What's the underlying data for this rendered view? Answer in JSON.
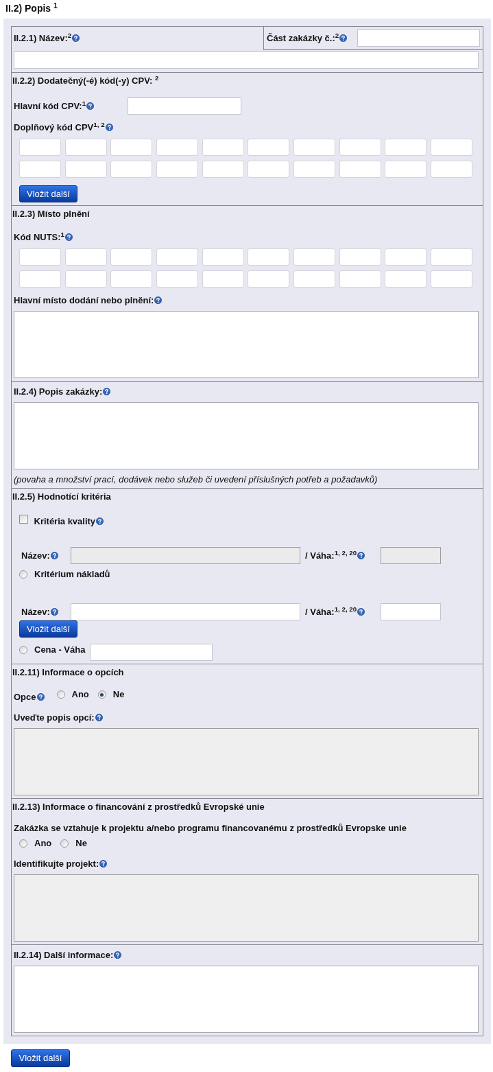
{
  "title": "II.2) Popis $^{1}$",
  "sections": [
    {
      "kind": "name_part",
      "name_label": {
        "text": "II.2.1) Název:$^{2}$",
        "help": true
      },
      "part_label": {
        "text": "Část zakázky č.:$^{2}$",
        "help": true
      }
    },
    {
      "kind": "group",
      "heading": {
        "text": "II.2.2) Dodatečný(-é) kód(-y) CPV: $^{2}$",
        "help": false
      },
      "items": [
        {
          "kind": "inline_field",
          "label": {
            "text": "Hlavní kód CPV:$^{1}$",
            "help": true
          }
        },
        {
          "kind": "label",
          "label": {
            "text": "Doplňový kód CPV$^{1, 2}$",
            "help": true
          }
        },
        {
          "kind": "field_grid"
        },
        {
          "kind": "button",
          "text": "Vložit další"
        }
      ]
    },
    {
      "kind": "group",
      "heading": {
        "text": "II.2.3) Místo plnění",
        "help": false
      },
      "items": [
        {
          "kind": "label",
          "label": {
            "text": "Kód NUTS:$^{1}$",
            "help": true
          }
        },
        {
          "kind": "field_grid"
        },
        {
          "kind": "label",
          "label": {
            "text": "Hlavní místo dodání nebo plnění:",
            "help": true
          }
        },
        {
          "kind": "textarea",
          "disabled": false
        }
      ]
    },
    {
      "kind": "group",
      "heading": {
        "text": "II.2.4) Popis zakázky:",
        "help": true
      },
      "items": [
        {
          "kind": "textarea",
          "disabled": false
        },
        {
          "kind": "note",
          "text": "(povaha a množství prací, dodávek nebo služeb či uvedení příslušných potřeb a požadavků)"
        }
      ]
    },
    {
      "kind": "group",
      "heading": {
        "text": "II.2.5) Hodnotící kritéria",
        "help": false
      },
      "items": [
        {
          "kind": "checkbox",
          "label": {
            "text": "Kritéria kvality",
            "help": true
          },
          "checked": false
        },
        {
          "kind": "criterion",
          "disabled": true,
          "name_label": {
            "text": "Název:",
            "help": true
          },
          "weight_label": {
            "text": "/ Váha:$^{1, 2, 20}$",
            "help": true
          }
        },
        {
          "kind": "radio",
          "label": {
            "text": "Kritérium nákladů",
            "help": false
          },
          "selected": false
        },
        {
          "kind": "criterion",
          "disabled": false,
          "name_label": {
            "text": "Název:",
            "help": true
          },
          "weight_label": {
            "text": "/ Váha:$^{1, 2, 20}$",
            "help": true
          }
        },
        {
          "kind": "button",
          "text": "Vložit další"
        },
        {
          "kind": "radio_field",
          "label": {
            "text": "Cena - Váha",
            "help": false
          },
          "selected": false
        }
      ]
    },
    {
      "kind": "group",
      "heading": {
        "text": "II.2.11) Informace o opcích",
        "help": false
      },
      "items": [
        {
          "kind": "radio_group",
          "label": {
            "text": "Opce",
            "help": true
          },
          "options": [
            {
              "text": "Ano",
              "selected": false
            },
            {
              "text": "Ne",
              "selected": true
            }
          ]
        },
        {
          "kind": "label",
          "label": {
            "text": "Uveďte popis opcí:",
            "help": true
          }
        },
        {
          "kind": "textarea",
          "disabled": true
        }
      ]
    },
    {
      "kind": "group",
      "heading": {
        "text": "II.2.13) Informace o financování z prostředků Evropské unie",
        "help": false
      },
      "items": [
        {
          "kind": "question",
          "label": {
            "text": "Zakázka se vztahuje k projektu a/nebo programu financovanému z prostředků Evropske unie",
            "help": false
          }
        },
        {
          "kind": "radio_group",
          "options": [
            {
              "text": "Ano",
              "selected": false
            },
            {
              "text": "Ne",
              "selected": false
            }
          ]
        },
        {
          "kind": "label",
          "label": {
            "text": "Identifikujte projekt:",
            "help": true
          }
        },
        {
          "kind": "textarea",
          "disabled": true
        }
      ]
    },
    {
      "kind": "group",
      "heading": {
        "text": "II.2.14) Další informace:",
        "help": true
      },
      "items": [
        {
          "kind": "textarea",
          "disabled": false
        }
      ]
    }
  ],
  "footer_button": "Vložit další"
}
